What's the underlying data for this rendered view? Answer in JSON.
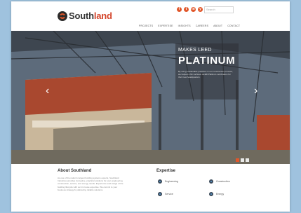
{
  "header": {
    "logo_prefix": "South",
    "logo_accent": "land",
    "search_placeholder": "Search",
    "social": [
      "f",
      "t",
      "in",
      "y"
    ],
    "nav": [
      "PROJECTS",
      "EXPERTISE",
      "INSIGHTS",
      "CAREERS",
      "ABOUT",
      "CONTACT"
    ]
  },
  "hero": {
    "pre_title": "MAKES LEED",
    "title": "PLATINUM",
    "description": "By using sustainable practices in our construction process, we helped a firm achieve LEED Platinum certification for their new headquarters."
  },
  "about": {
    "title": "About Southland",
    "text": "As one of the nation's largest building systems experts, Southland Industries provides innovative, practical solutions for your engineering, construction, service, and energy needs. Experience each stage of the building lifecycle with our in-house expertise. We commit to your business strategy by delivering reliable solutions."
  },
  "expertise": {
    "title": "Expertise",
    "items": [
      "Engineering",
      "Construction",
      "Service",
      "Energy"
    ]
  },
  "colors": {
    "accent": "#e1572a",
    "page_background": "#9fc2de",
    "dark_text": "#333333"
  }
}
